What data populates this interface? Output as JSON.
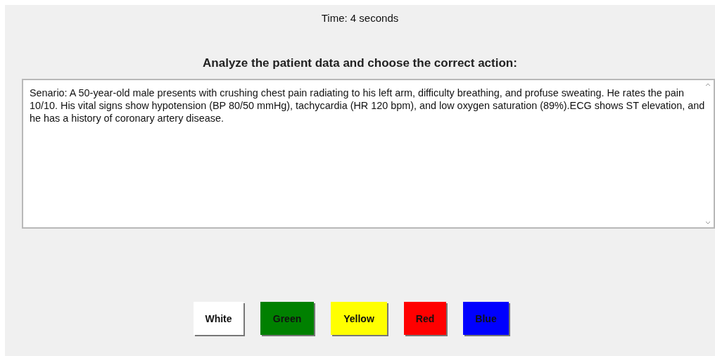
{
  "timer": "Time: 4 seconds",
  "prompt": "Analyze the patient data and choose the correct action:",
  "scenario": {
    "value": "Senario: A 50-year-old male presents with crushing chest pain radiating to his left arm, difficulty breathing, and profuse sweating. He rates the pain 10/10. His vital signs show hypotension (BP 80/50 mmHg), tachycardia (HR 120 bpm), and low oxygen saturation (89%).ECG shows ST elevation, and he has a history of coronary artery disease."
  },
  "buttons": [
    {
      "label": "White",
      "color": "#ffffff"
    },
    {
      "label": "Green",
      "color": "#008000"
    },
    {
      "label": "Yellow",
      "color": "#ffff00"
    },
    {
      "label": "Red",
      "color": "#ff0000"
    },
    {
      "label": "Blue",
      "color": "#0000ff"
    }
  ]
}
